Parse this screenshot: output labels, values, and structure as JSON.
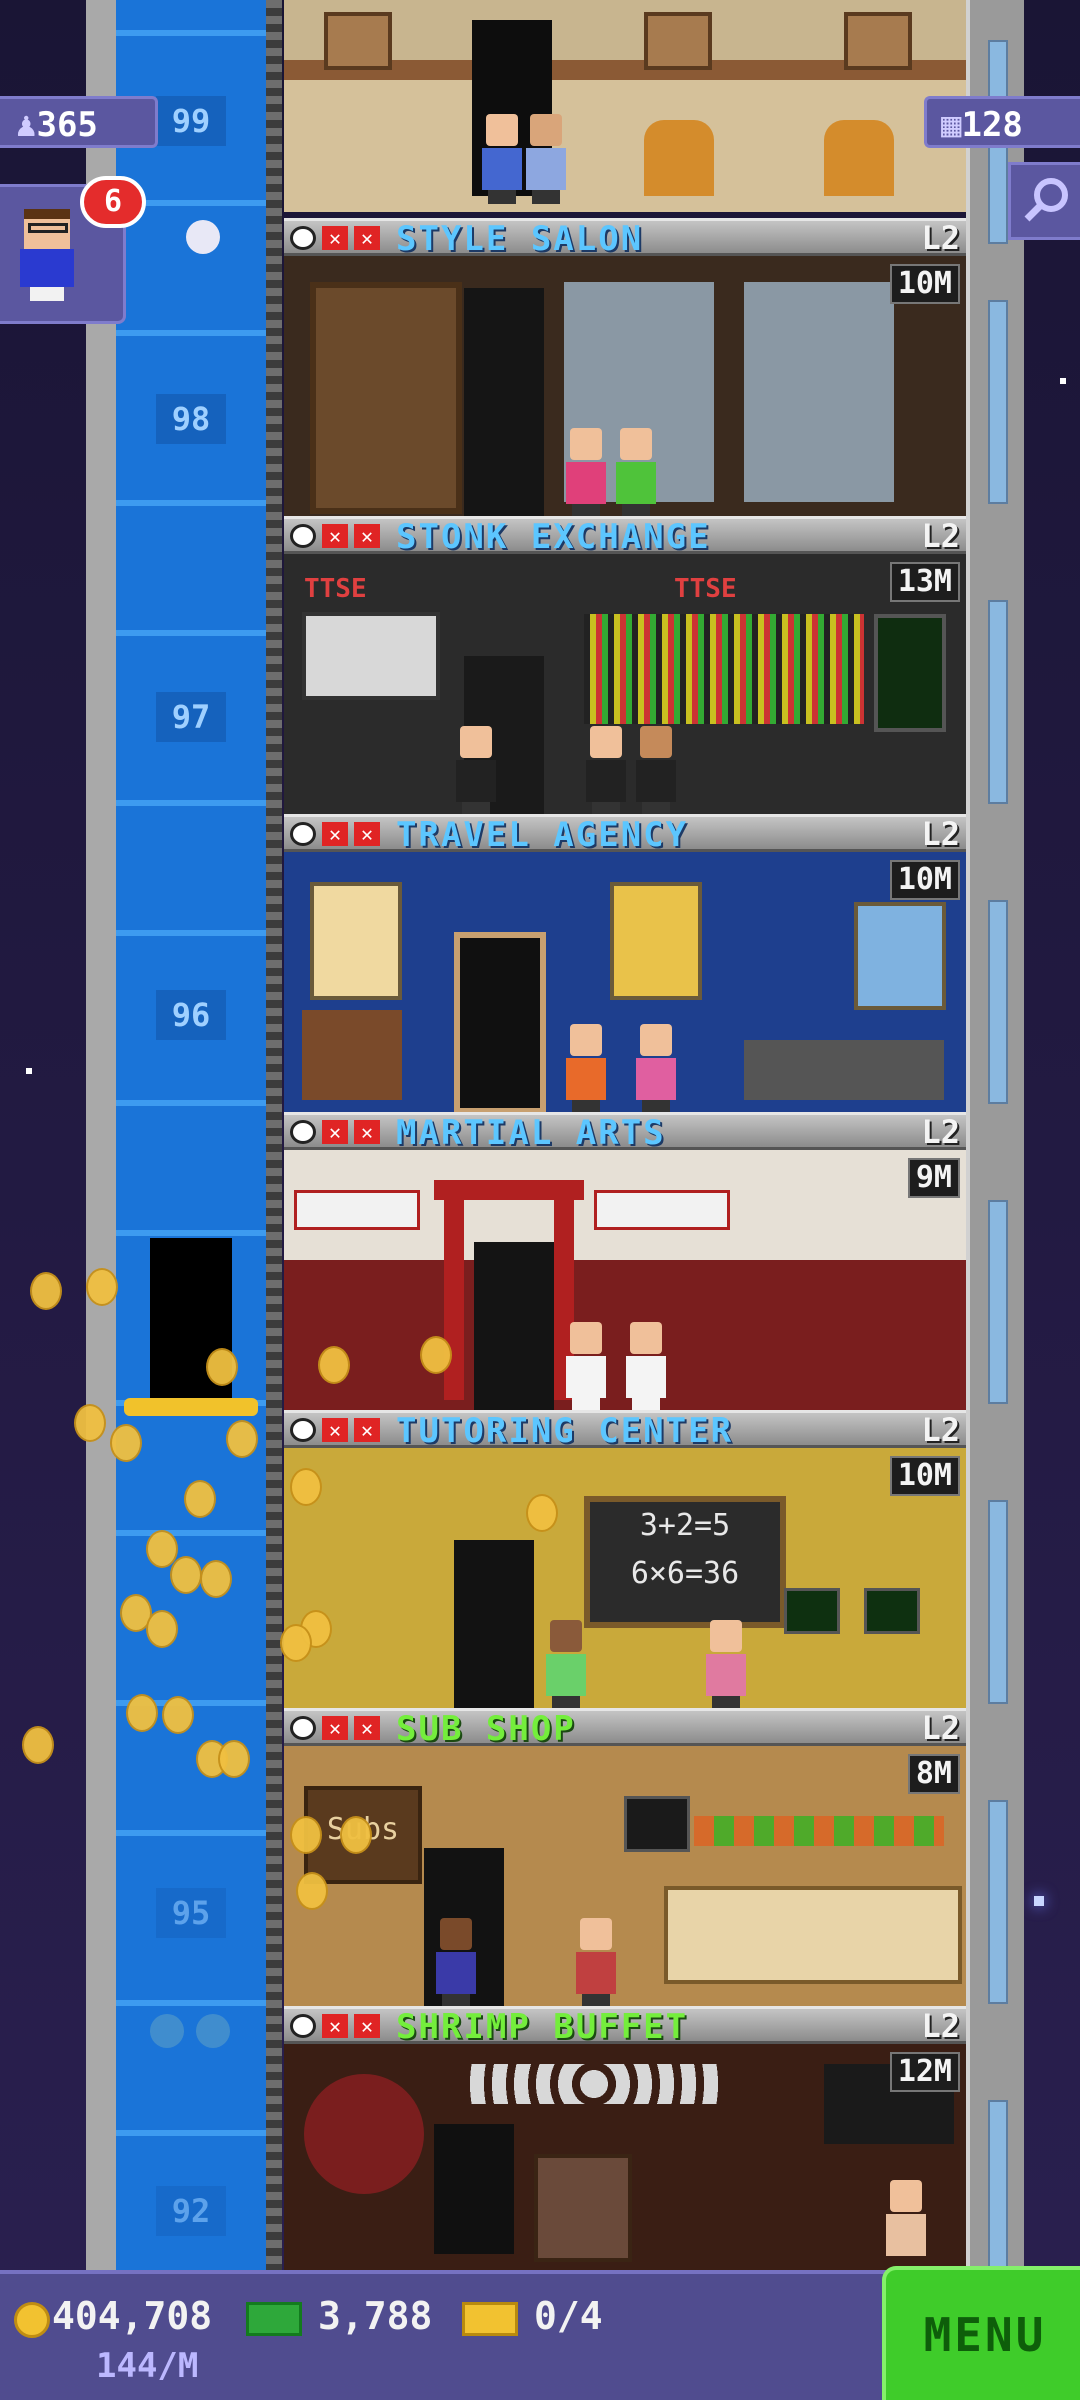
{
  "hud": {
    "population": "365",
    "floor_count": "128",
    "notification_count": "6"
  },
  "elevator": {
    "floor_numbers": [
      "99",
      "98",
      "97",
      "96",
      "95",
      "92"
    ]
  },
  "floors": [
    {
      "name": "STYLE SALON",
      "level": "L2",
      "price": "10M",
      "color": "blue"
    },
    {
      "name": "STONK EXCHANGE",
      "level": "L2",
      "price": "13M",
      "color": "blue"
    },
    {
      "name": "TRAVEL AGENCY",
      "level": "L2",
      "price": "10M",
      "color": "blue"
    },
    {
      "name": "MARTIAL ARTS",
      "level": "L2",
      "price": "9M",
      "color": "blue"
    },
    {
      "name": "TUTORING CENTER",
      "level": "L2",
      "price": "10M",
      "color": "blue"
    },
    {
      "name": "SUB SHOP",
      "level": "L2",
      "price": "8M",
      "color": "green"
    },
    {
      "name": "SHRIMP BUFFET",
      "level": "L2",
      "price": "12M",
      "color": "green"
    }
  ],
  "room_signs": {
    "stonk_left": "TTSE",
    "stonk_right": "TTSE",
    "chalkboard_line1": "3+2=5",
    "chalkboard_line2": "6×6=36",
    "sub_sign": "Subs"
  },
  "bottom_bar": {
    "coins": "404,708",
    "coins_rate": "144/M",
    "bux": "3,788",
    "tickets": "0/4",
    "menu_label": "MENU"
  },
  "colors": {
    "elevator": "#1a74d8",
    "hud": "#5b57a0",
    "menu": "#3fcc2a",
    "banner_text_blue": "#5cc6ff",
    "banner_text_green": "#74ee3c"
  },
  "icons": [
    "population-icon",
    "building-icon",
    "search-icon",
    "clock-icon",
    "close-icon",
    "coin-icon",
    "bux-icon",
    "ticket-icon"
  ]
}
